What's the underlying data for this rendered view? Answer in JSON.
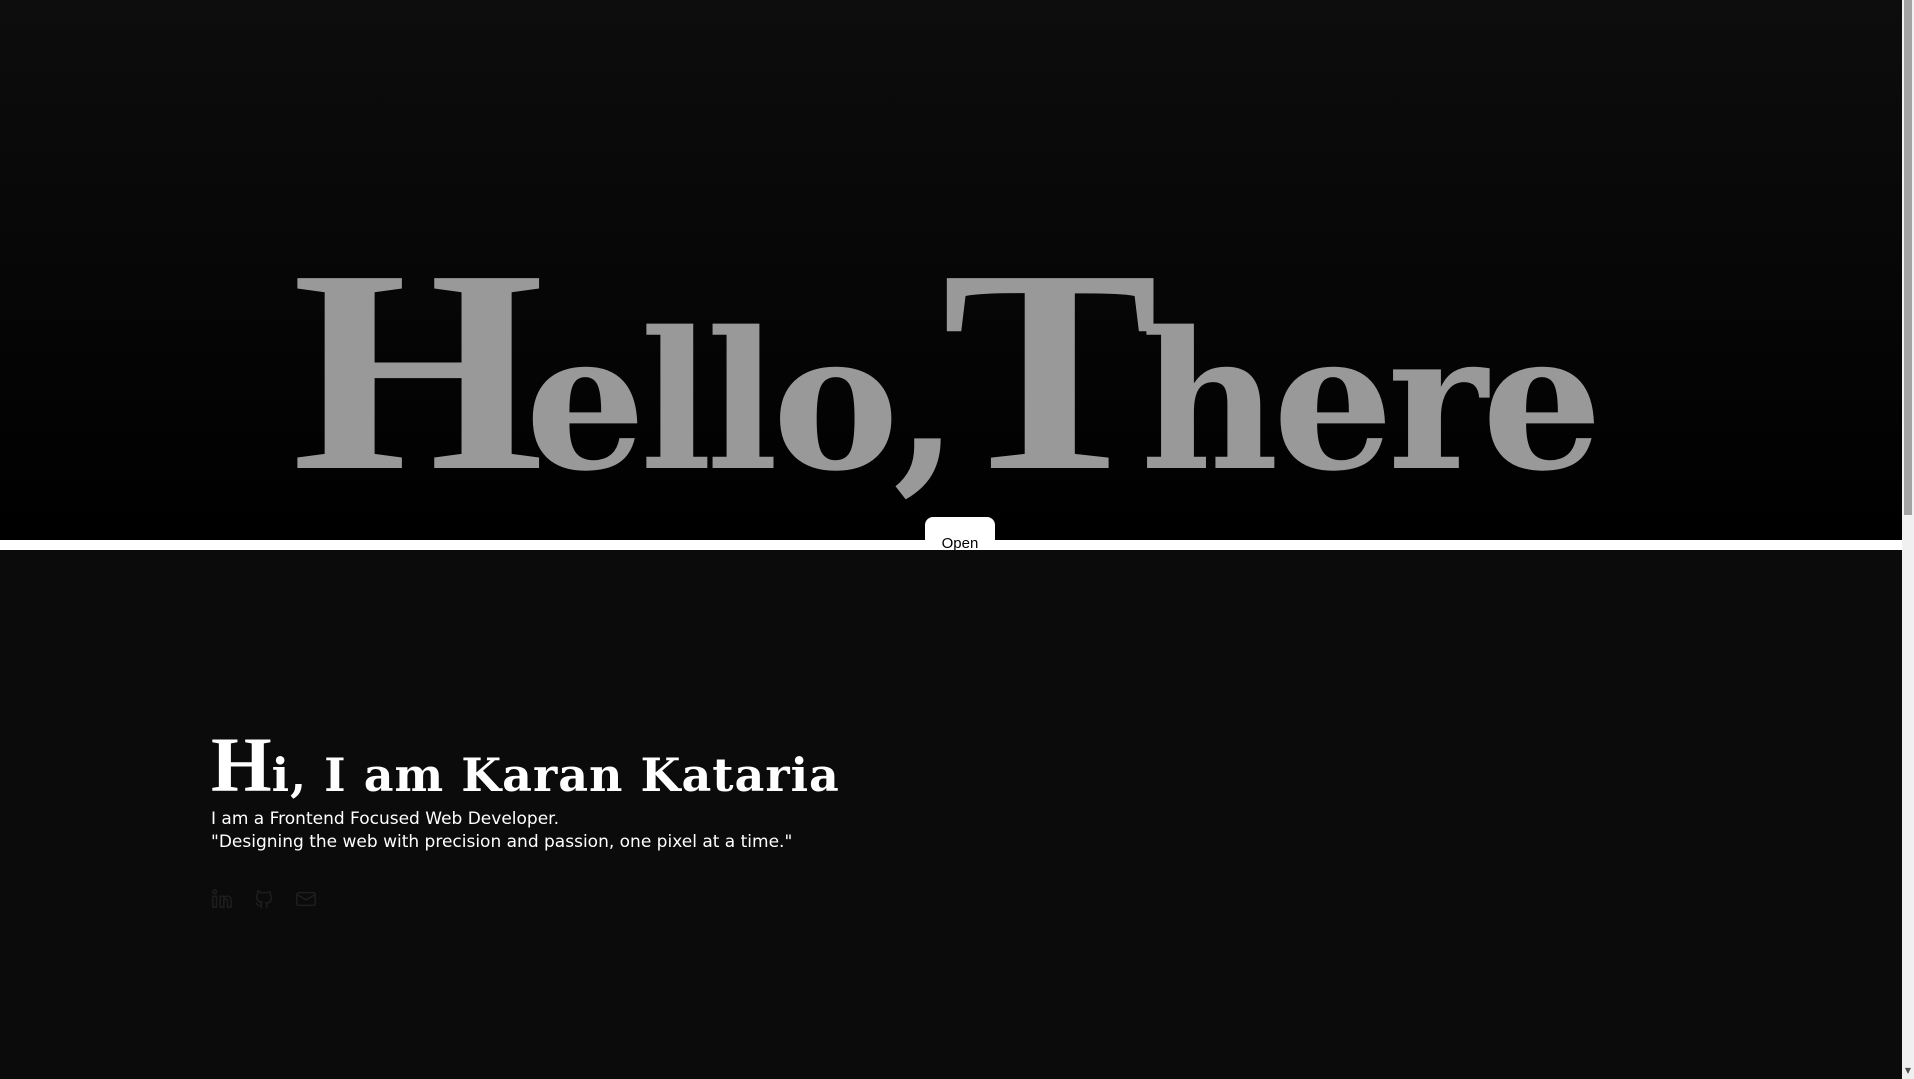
{
  "hero": {
    "cap1": "H",
    "rest1": "ello,",
    "cap2": "T",
    "rest2": "here"
  },
  "open_button_label": "Open",
  "intro": {
    "title_cap": "H",
    "title_rest": "i, I am Karan Kataria",
    "line1": "I am a Frontend Focused Web Developer.",
    "line2": "\"Designing the web with precision and passion, one pixel at a time.\""
  },
  "socials": [
    {
      "icon": "linkedin-icon"
    },
    {
      "icon": "github-icon"
    },
    {
      "icon": "mail-icon"
    }
  ],
  "colors": {
    "background": "#0b0b0b",
    "hero_text": "#999999",
    "divider": "#ffffff",
    "intro_text": "#ffffff",
    "social_icons": "#1e1e1e"
  }
}
